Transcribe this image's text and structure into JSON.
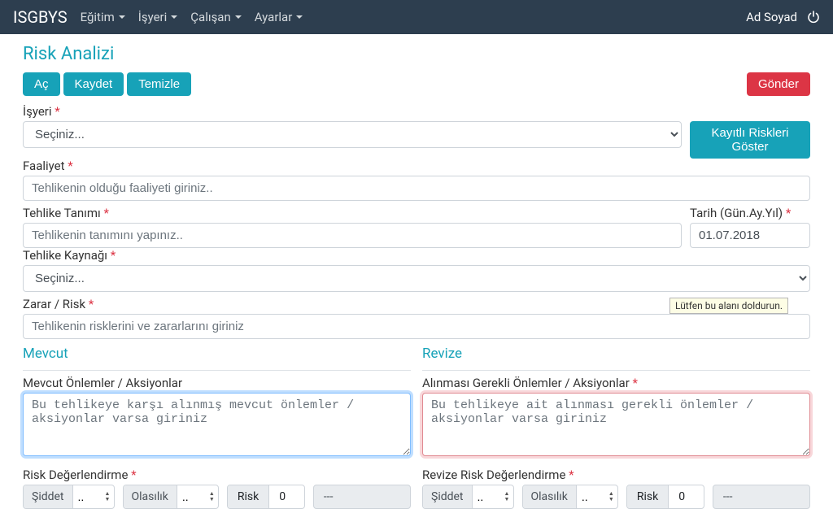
{
  "navbar": {
    "brand": "ISGBYS",
    "items": [
      "Eğitim",
      "İşyeri",
      "Çalışan",
      "Ayarlar"
    ],
    "user": "Ad Soyad"
  },
  "page": {
    "title": "Risk Analizi"
  },
  "buttons": {
    "open": "Aç",
    "save": "Kaydet",
    "clear": "Temizle",
    "send": "Gönder",
    "saved_risks": "Kayıtlı Riskleri Göster"
  },
  "labels": {
    "workplace": "İşyeri",
    "activity": "Faaliyet",
    "hazard_def": "Tehlike Tanımı",
    "date": "Tarih (Gün.Ay.Yıl)",
    "hazard_source": "Tehlike Kaynağı",
    "damage_risk": "Zarar / Risk",
    "current_section": "Mevcut",
    "revised_section": "Revize",
    "current_measures": "Mevcut Önlemler / Aksiyonlar",
    "required_measures": "Alınması Gerekli Önlemler / Aksiyonlar",
    "risk_assessment": "Risk Değerlendirme",
    "revised_risk_assessment": "Revize Risk Değerlendirme",
    "severity": "Şiddet",
    "probability": "Olasılık",
    "risk": "Risk"
  },
  "placeholders": {
    "select": "Seçiniz...",
    "activity": "Tehlikenin olduğu faaliyeti giriniz..",
    "hazard_def": "Tehlikenin tanımını yapınız..",
    "damage_risk": "Tehlikenin risklerini ve zararlarını giriniz",
    "current_measures": "Bu tehlikeye karşı alınmış mevcut önlemler / aksiyonlar varsa giriniz",
    "required_measures": "Bu tehlikeye ait alınması gerekli önlemler / aksiyonlar varsa giriniz"
  },
  "values": {
    "date": "01.07.2018",
    "severity_dots": "..",
    "probability_dots": "..",
    "risk_value": "0",
    "risk_status": "---"
  },
  "tooltip": "Lütfen bu alanı doldurun."
}
